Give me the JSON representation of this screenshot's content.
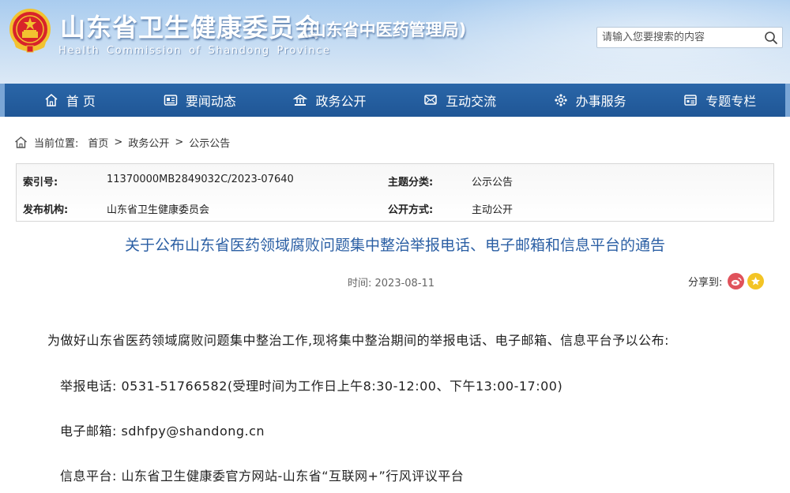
{
  "header": {
    "title": "山东省卫生健康委员会",
    "subtitle": "(山东省中医药管理局)",
    "english": "Health Commission of Shandong Province",
    "search_placeholder": "请输入您要搜索的内容"
  },
  "nav": {
    "items": [
      {
        "label": "首 页",
        "icon": "home-icon"
      },
      {
        "label": "要闻动态",
        "icon": "news-icon"
      },
      {
        "label": "政务公开",
        "icon": "government-icon"
      },
      {
        "label": "互动交流",
        "icon": "interaction-icon"
      },
      {
        "label": "办事服务",
        "icon": "service-icon"
      },
      {
        "label": "专题专栏",
        "icon": "topic-icon"
      }
    ]
  },
  "breadcrumb": {
    "label": "当前位置:",
    "items": [
      "首页",
      "政务公开",
      "公示公告"
    ],
    "separator": ">"
  },
  "info": {
    "index_label": "索引号:",
    "index_value": "11370000MB2849032C/2023-07640",
    "topic_label": "主题分类:",
    "topic_value": "公示公告",
    "issuer_label": "发布机构:",
    "issuer_value": "山东省卫生健康委员会",
    "mode_label": "公开方式:",
    "mode_value": "主动公开"
  },
  "article": {
    "title": "关于公布山东省医药领域腐败问题集中整治举报电话、电子邮箱和信息平台的通告",
    "time": "时间: 2023-08-11",
    "share_label": "分享到:",
    "paragraphs": [
      "为做好山东省医药领域腐败问题集中整治工作,现将集中整治期间的举报电话、电子邮箱、信息平台予以公布:",
      "举报电话: 0531-51766582(受理时间为工作日上午8:30-12:00、下午13:00-17:00)",
      "电子邮箱: sdhfpy@shandong.cn",
      "信息平台: 山东省卫生健康委官方网站-山东省“互联网+”行风评议平台"
    ]
  },
  "colors": {
    "nav_bg": "#2a66a8",
    "title_blue": "#2b5fa4",
    "weibo_red": "#e0525b",
    "fav_yellow": "#f3c425"
  }
}
